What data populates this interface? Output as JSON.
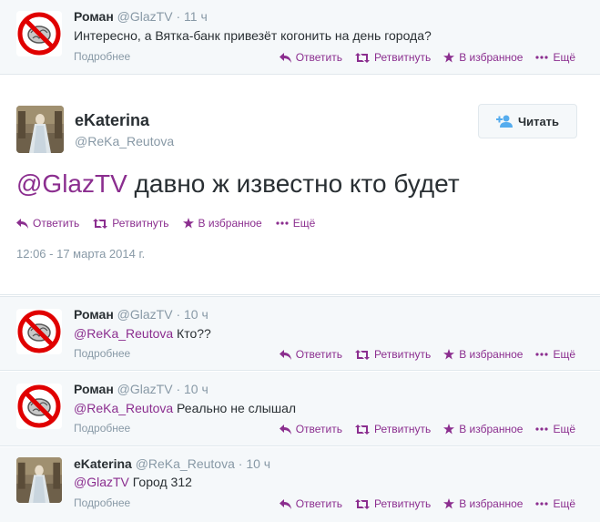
{
  "action_labels": {
    "reply": "Ответить",
    "retweet": "Ретвитнуть",
    "favorite": "В избранное",
    "more": "Ещё"
  },
  "tweets_top": [
    {
      "name": "Роман",
      "handle": "@GlazTV",
      "dot": "·",
      "time": "11 ч",
      "text": "Интересно, а Вятка-банк привезёт когонить на день города?",
      "details": "Подробнее"
    }
  ],
  "main_tweet": {
    "name": "eKaterina",
    "handle": "@ReKa_Reutova",
    "follow_label": "Читать",
    "mention": "@GlazTV",
    "text": " давно ж известно кто будет",
    "timestamp": "12:06 - 17 марта 2014 г."
  },
  "replies": [
    {
      "name": "Роман",
      "handle": "@GlazTV",
      "dot": "·",
      "time": "10 ч",
      "mention": "@ReKa_Reutova",
      "text": " Кто??",
      "details": "Подробнее"
    },
    {
      "name": "Роман",
      "handle": "@GlazTV",
      "dot": "·",
      "time": "10 ч",
      "mention": "@ReKa_Reutova",
      "text": " Реально не слышал",
      "details": "Подробнее"
    },
    {
      "name": "eKaterina",
      "handle": "@ReKa_Reutova",
      "dot": "·",
      "time": "10 ч",
      "mention": "@GlazTV",
      "text": " Город 312",
      "details": "Подробнее"
    }
  ],
  "colors": {
    "accent": "#8b2e8f",
    "muted": "#8899a6",
    "bg_gray": "#f5f8fa",
    "border": "#e1e8ed"
  }
}
